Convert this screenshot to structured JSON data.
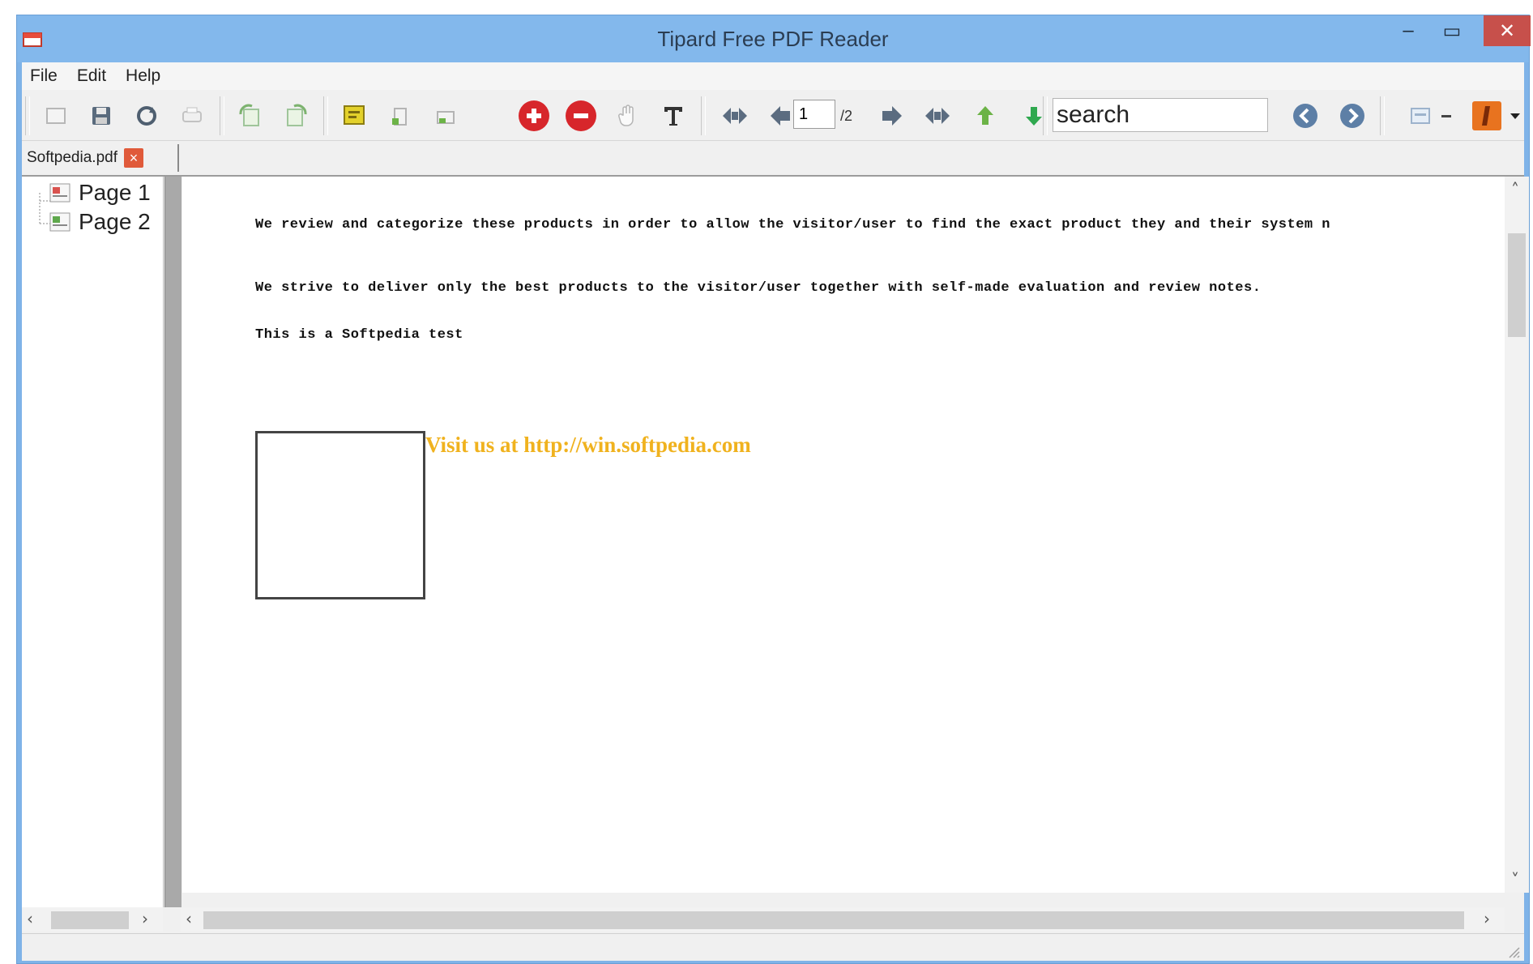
{
  "window": {
    "title": "Tipard Free PDF Reader",
    "minimize_glyph": "–",
    "maximize_glyph": "▭",
    "close_glyph": "✕"
  },
  "menu": {
    "items": [
      "File",
      "Edit",
      "Help"
    ]
  },
  "toolbar": {
    "page_number": "1",
    "page_total": "/2",
    "search_text": "search",
    "icons": [
      "open-icon",
      "save-icon",
      "refresh-icon",
      "print-icon",
      "rotate-left-icon",
      "rotate-right-icon",
      "highlight-icon",
      "fit-width-icon",
      "fit-page-icon",
      "zoom-in-icon",
      "zoom-out-icon",
      "hand-tool-icon",
      "text-select-icon",
      "first-page-icon",
      "previous-page-icon",
      "next-page-icon",
      "last-page-icon",
      "navigate-back-icon",
      "navigate-forward-icon",
      "search-previous-icon",
      "search-next-icon",
      "view-mode-icon",
      "settings-icon"
    ]
  },
  "tab": {
    "label": "Softpedia.pdf",
    "close_glyph": "×"
  },
  "sidebar": {
    "pages": [
      "Page 1",
      "Page 2"
    ]
  },
  "document": {
    "line1": "We review and categorize these products in order to allow the visitor/user to find the exact product they and their system n",
    "line2": "We strive to deliver only the best products to the visitor/user together with self-made evaluation and review notes.",
    "line3": "This is a Softpedia test",
    "link": "Visit us at http://win.softpedia.com"
  },
  "colors": {
    "titlebar": "#83b8ec",
    "close_button": "#c7504b",
    "link_text": "#f0b21e",
    "zoom_buttons": "#d7262b"
  }
}
